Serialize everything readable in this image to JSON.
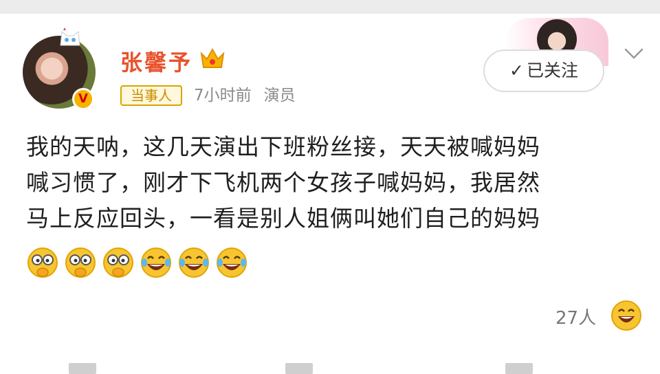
{
  "post": {
    "username": "张馨予",
    "tag": "当事人",
    "time": "7小时前",
    "role": "演员",
    "follow_label": "已关注",
    "follow_check": "✓",
    "lines": [
      "我的天呐，这几天演出下班粉丝接，天天被喊妈妈",
      "喊习惯了，刚才下飞机两个女孩子喊妈妈，我居然",
      "马上反应回头，一看是别人姐俩叫她们自己的妈妈"
    ],
    "emojis": [
      "monocle-hand-emoji",
      "monocle-hand-emoji",
      "monocle-hand-emoji",
      "laugh-cry-emoji",
      "laugh-cry-emoji",
      "laugh-cry-emoji"
    ],
    "likes": "27人"
  },
  "colors": {
    "username": "#e8532c",
    "tag_border": "#d9a300",
    "meta": "#8a8a8a",
    "emoji_yellow": "#f7c531"
  }
}
